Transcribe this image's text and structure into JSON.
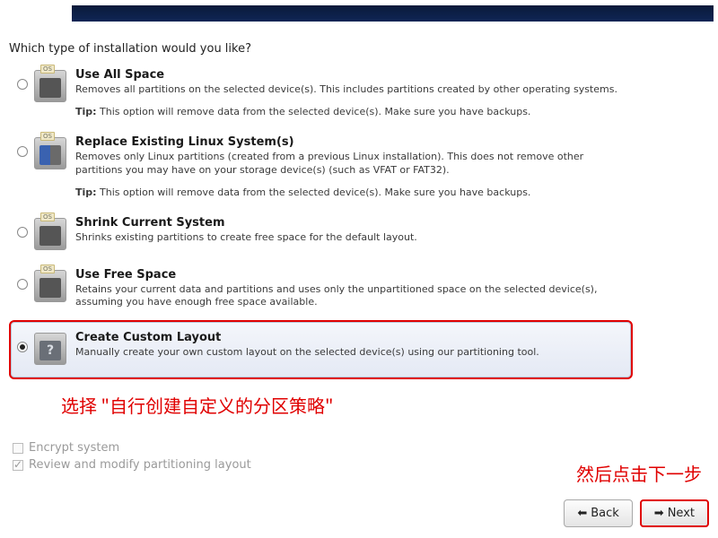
{
  "prompt": "Which type of installation would you like?",
  "options": [
    {
      "key": "use-all-space",
      "title": "Use All Space",
      "desc": "Removes all partitions on the selected device(s).  This includes partitions created by other operating systems.",
      "tip_label": "Tip:",
      "tip": "This option will remove data from the selected device(s).  Make sure you have backups.",
      "selected": false,
      "icon": "full"
    },
    {
      "key": "replace-existing",
      "title": "Replace Existing Linux System(s)",
      "desc": "Removes only Linux partitions (created from a previous Linux installation).  This does not remove other partitions you may have on your storage device(s) (such as VFAT or FAT32).",
      "tip_label": "Tip:",
      "tip": "This option will remove data from the selected device(s).  Make sure you have backups.",
      "selected": false,
      "icon": "split"
    },
    {
      "key": "shrink-current",
      "title": "Shrink Current System",
      "desc": "Shrinks existing partitions to create free space for the default layout.",
      "tip_label": "",
      "tip": "",
      "selected": false,
      "icon": "full"
    },
    {
      "key": "use-free-space",
      "title": "Use Free Space",
      "desc": "Retains your current data and partitions and uses only the unpartitioned space on the selected device(s), assuming you have enough free space available.",
      "tip_label": "",
      "tip": "",
      "selected": false,
      "icon": "full"
    },
    {
      "key": "custom-layout",
      "title": "Create Custom Layout",
      "desc": "Manually create your own custom layout on the selected device(s) using our partitioning tool.",
      "tip_label": "",
      "tip": "",
      "selected": true,
      "icon": "question"
    }
  ],
  "checkboxes": {
    "encrypt": {
      "label": "Encrypt system",
      "checked": false,
      "enabled": false
    },
    "review": {
      "label": "Review and modify partitioning layout",
      "checked": true,
      "enabled": false
    }
  },
  "buttons": {
    "back": "Back",
    "next": "Next"
  },
  "annotations": {
    "select_custom": "选择 \"自行创建自定义的分区策略\"",
    "click_next": "然后点击下一步"
  },
  "os_tag": "OS"
}
